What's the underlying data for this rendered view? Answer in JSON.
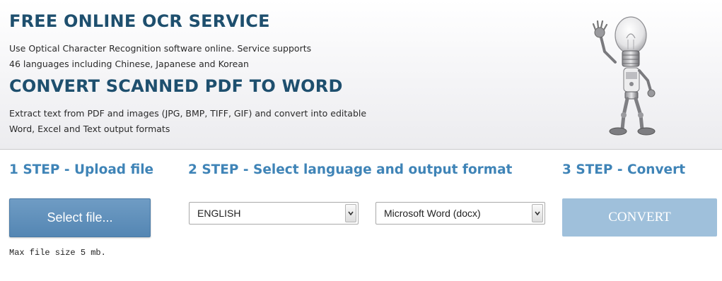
{
  "hero": {
    "title1": "FREE ONLINE OCR SERVICE",
    "desc1_line1": "Use Optical Character Recognition software online. Service supports",
    "desc1_line2": "46 languages including Chinese, Japanese and Korean",
    "title2": "CONVERT SCANNED PDF TO WORD",
    "desc2_line1": "Extract text from PDF and images (JPG, BMP, TIFF, GIF) and convert into editable",
    "desc2_line2": "Word, Excel and Text output formats",
    "mascot_icon": "lightbulb-robot-icon"
  },
  "steps": {
    "step1": {
      "title": "1 STEP - Upload file",
      "button_label": "Select file...",
      "note": "Max file size 5 mb."
    },
    "step2": {
      "title": "2 STEP - Select language and output format",
      "language_value": "ENGLISH",
      "format_value": "Microsoft Word (docx)"
    },
    "step3": {
      "title": "3 STEP - Convert",
      "button_label": "CONVERT"
    }
  },
  "colors": {
    "heading": "#1e4f6e",
    "step_title": "#3f84b7",
    "select_button": "#5b8cb9",
    "convert_button_disabled": "#9fc0db"
  }
}
